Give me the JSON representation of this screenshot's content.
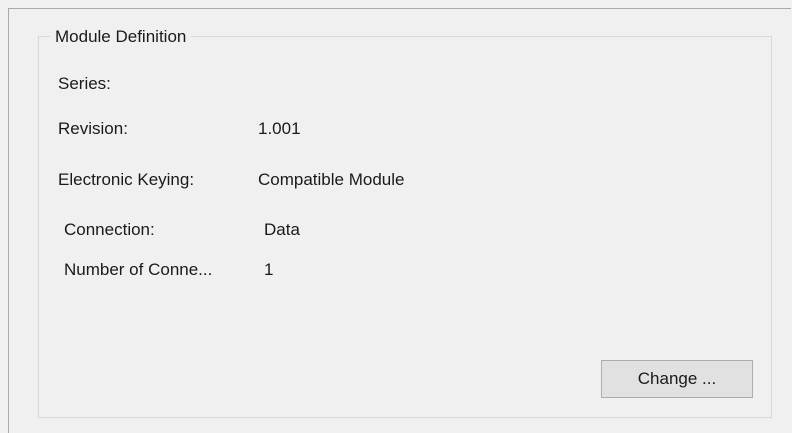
{
  "group": {
    "title": "Module Definition"
  },
  "rows": {
    "series": {
      "label": "Series:",
      "value": ""
    },
    "revision": {
      "label": "Revision:",
      "value": "1.001"
    },
    "keying": {
      "label": "Electronic Keying:",
      "value": "Compatible Module"
    },
    "connection": {
      "label": "Connection:",
      "value": "Data"
    },
    "num_connections": {
      "label": "Number of Conne...",
      "value": "1"
    }
  },
  "buttons": {
    "change": "Change ..."
  }
}
